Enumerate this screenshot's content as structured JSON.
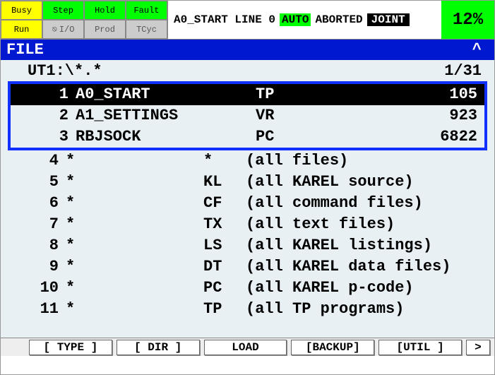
{
  "status": {
    "busy": {
      "label": "Busy",
      "cls": "yellow"
    },
    "step": {
      "label": "Step",
      "cls": "green"
    },
    "hold": {
      "label": "Hold",
      "cls": "green"
    },
    "fault": {
      "label": "Fault",
      "cls": "green"
    },
    "run": {
      "label": "Run",
      "cls": "yellow"
    },
    "io": {
      "label": "I/O",
      "cls": ""
    },
    "prod": {
      "label": "Prod",
      "cls": ""
    },
    "tcyc": {
      "label": "TCyc",
      "cls": ""
    }
  },
  "program": {
    "text_pre": "A0_START LINE 0",
    "auto": "AUTO",
    "aborted": "ABORTED",
    "joint": "JOINT"
  },
  "percent": "12%",
  "title": "FILE",
  "caret": "^",
  "path": "UT1:\\*.*",
  "counter": "1/31",
  "rows": [
    {
      "idx": "1",
      "name": "A0_START",
      "ext": "TP",
      "size": "105",
      "sel": true
    },
    {
      "idx": "2",
      "name": "A1_SETTINGS",
      "ext": "VR",
      "size": "923",
      "sel": false
    },
    {
      "idx": "3",
      "name": "RBJSOCK",
      "ext": "PC",
      "size": "6822",
      "sel": false
    }
  ],
  "filters": [
    {
      "idx": "4",
      "name": "*",
      "ext": "* ",
      "desc": "(all files)"
    },
    {
      "idx": "5",
      "name": "*",
      "ext": "KL",
      "desc": "(all KAREL source)"
    },
    {
      "idx": "6",
      "name": "*",
      "ext": "CF",
      "desc": "(all command files)"
    },
    {
      "idx": "7",
      "name": "*",
      "ext": "TX",
      "desc": "(all text files)"
    },
    {
      "idx": "8",
      "name": "*",
      "ext": "LS",
      "desc": "(all KAREL listings)"
    },
    {
      "idx": "9",
      "name": "*",
      "ext": "DT",
      "desc": "(all KAREL data files)"
    },
    {
      "idx": "10",
      "name": "*",
      "ext": "PC",
      "desc": "(all KAREL p-code)"
    },
    {
      "idx": "11",
      "name": "*",
      "ext": "TP",
      "desc": "(all TP programs)"
    }
  ],
  "footer": {
    "type": "[ TYPE ]",
    "dir": "[ DIR ]",
    "load": "LOAD",
    "backup": "[BACKUP]",
    "util": "[UTIL ]",
    "next": ">"
  }
}
